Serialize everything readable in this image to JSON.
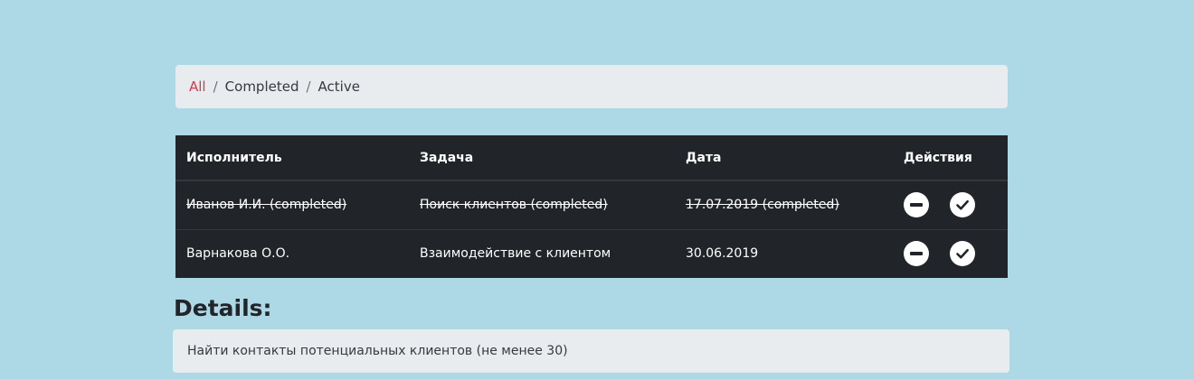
{
  "breadcrumb": {
    "items": [
      "All",
      "Completed",
      "Active"
    ],
    "separator": "/"
  },
  "table": {
    "headers": [
      "Исполнитель",
      "Задача",
      "Дата",
      "Действия"
    ],
    "rows": [
      {
        "executor": "Иванов И.И. (completed)",
        "task": "Поиск клиентов (completed)",
        "date": "17.07.2019 (completed)",
        "completed": true
      },
      {
        "executor": "Варнакова О.О.",
        "task": "Взаимодействие с клиентом",
        "date": "30.06.2019",
        "completed": false
      }
    ],
    "actions": [
      "minus-circle-icon",
      "check-circle-icon"
    ]
  },
  "details": {
    "title": "Details:",
    "text": "Найти контакты потенциальных клиентов (не менее 30)"
  },
  "colors": {
    "background": "#add8e6",
    "table_bg": "#212529",
    "panel_bg": "#e9ecef",
    "active_link": "#dc3545"
  }
}
